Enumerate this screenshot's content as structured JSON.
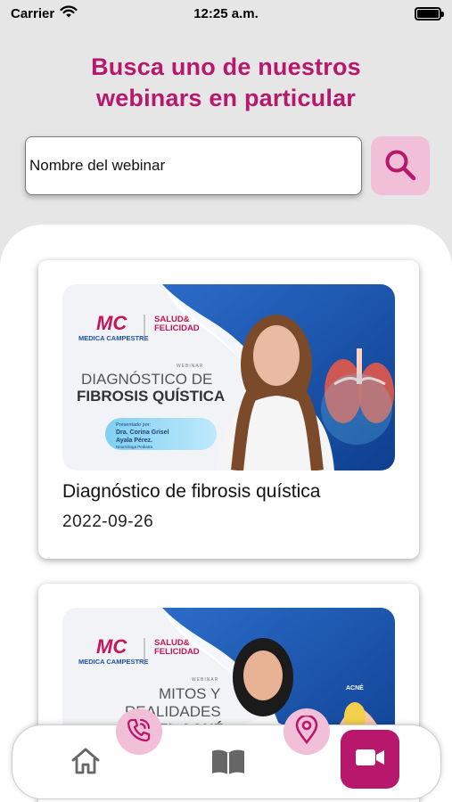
{
  "status_bar": {
    "carrier": "Carrier",
    "time": "12:25 a.m."
  },
  "header": {
    "title_line1": "Busca uno de nuestros",
    "title_line2": "webinars en particular"
  },
  "search": {
    "placeholder": "Nombre del webinar",
    "icon": "search-icon"
  },
  "webinars": [
    {
      "title": "Diagnóstico de fibrosis quística",
      "date": "2022-09-26",
      "thumbnail": {
        "brand_left_mark": "MC",
        "brand_left_name": "MEDICA CAMPESTRE",
        "brand_right_line1": "SALUD&",
        "brand_right_line2": "FELICIDAD",
        "kind": "WEBINAR",
        "heading_line1": "DIAGNÓSTICO DE",
        "heading_line2": "FIBROSIS QUÍSTICA",
        "presenter_intro": "Presentado por:",
        "presenter_name1": "Dra. Corina Grisel",
        "presenter_name2": "Ayala Pérez.",
        "presenter_role": "Neumóloga Pediatra"
      }
    },
    {
      "title": "",
      "date": "",
      "thumbnail": {
        "brand_left_mark": "MC",
        "brand_left_name": "MEDICA CAMPESTRE",
        "brand_right_line1": "SALUD&",
        "brand_right_line2": "FELICIDAD",
        "kind": "WEBINAR",
        "heading_line1": "MITOS Y",
        "heading_line2": "REALIDADES",
        "heading_line3": "DEL ACNÉ",
        "tag": "ACNÉ"
      }
    }
  ],
  "bottom_nav": {
    "items": [
      "home-icon",
      "phone-icon",
      "book-icon",
      "location-icon",
      "video-camera-icon"
    ],
    "active": "video-camera-icon"
  },
  "colors": {
    "brand_magenta": "#b7186c",
    "brand_pink_light": "#f2bfd8",
    "banner_blue": "#1e4fa8",
    "background_gray": "#e6e6e6"
  }
}
